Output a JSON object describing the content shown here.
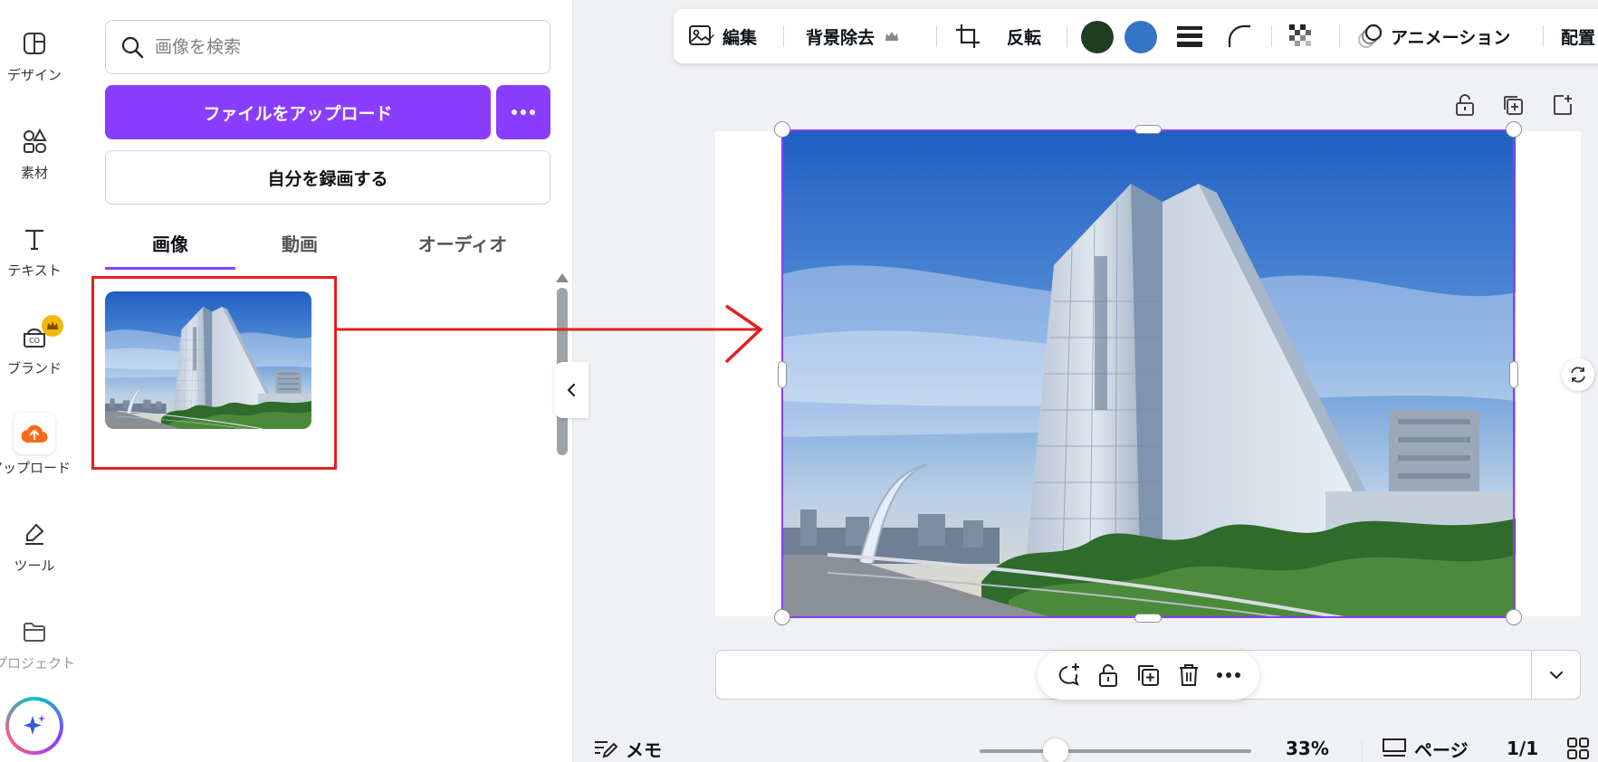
{
  "rail": {
    "items": [
      {
        "label": "デザイン",
        "icon": "layout-icon"
      },
      {
        "label": "素材",
        "icon": "shapes-icon"
      },
      {
        "label": "テキスト",
        "icon": "text-icon"
      },
      {
        "label": "ブランド",
        "icon": "brand-icon"
      },
      {
        "label": "アップロード",
        "icon": "cloud-upload-icon"
      },
      {
        "label": "ツール",
        "icon": "pen-tool-icon"
      },
      {
        "label": "プロジェクト",
        "icon": "folder-icon"
      }
    ]
  },
  "panel": {
    "search_placeholder": "画像を検索",
    "upload_label": "ファイルをアップロード",
    "record_label": "自分を録画する",
    "tabs": [
      {
        "label": "画像",
        "active": true
      },
      {
        "label": "動画",
        "active": false
      },
      {
        "label": "オーディオ",
        "active": false
      }
    ]
  },
  "toolbar": {
    "edit_label": "編集",
    "bg_remove_label": "背景除去",
    "flip_label": "反転",
    "animate_label": "アニメーション",
    "position_label": "配置",
    "colors": [
      "#1f3d21",
      "#3575c6"
    ]
  },
  "footer": {
    "notes_label": "メモ",
    "zoom_value": 33,
    "zoom_label": "33%",
    "pages_label": "ページ",
    "page_count": "1/1"
  },
  "colors": {
    "accent": "#8b3dff",
    "annotation": "#e02020"
  }
}
